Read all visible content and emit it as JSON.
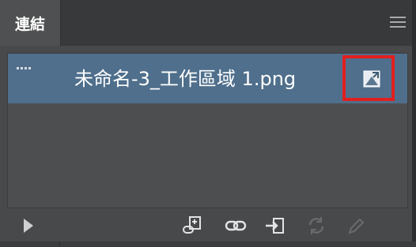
{
  "panel": {
    "tab_label": "連結",
    "menu_icon": "hamburger-menu-icon"
  },
  "links": [
    {
      "filename": "未命名-3_工作區域 1.png",
      "thumbnail_icon": "thumbnail-icon",
      "status_icon": "embed-link-icon",
      "highlighted": true
    }
  ],
  "toolbar": {
    "icons": [
      "expand-arrow-icon",
      "relink-from-cc-library-icon",
      "relink-icon",
      "go-to-link-icon",
      "update-link-icon",
      "edit-original-icon"
    ]
  },
  "colors": {
    "panel_bg": "#48494a",
    "header_bg": "#38393a",
    "selected_row": "#4f6f8c",
    "highlight_box": "#e21f1f",
    "text": "#ffffff"
  }
}
